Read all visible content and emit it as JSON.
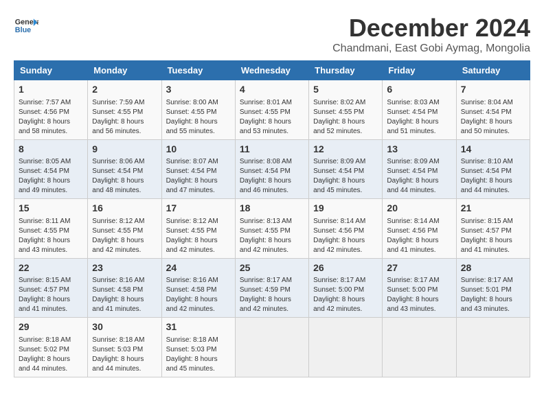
{
  "logo": {
    "line1": "General",
    "line2": "Blue"
  },
  "title": "December 2024",
  "location": "Chandmani, East Gobi Aymag, Mongolia",
  "weekdays": [
    "Sunday",
    "Monday",
    "Tuesday",
    "Wednesday",
    "Thursday",
    "Friday",
    "Saturday"
  ],
  "weeks": [
    [
      {
        "day": "1",
        "rise": "7:57 AM",
        "set": "4:56 PM",
        "daylight": "8 hours and 58 minutes."
      },
      {
        "day": "2",
        "rise": "7:59 AM",
        "set": "4:55 PM",
        "daylight": "8 hours and 56 minutes."
      },
      {
        "day": "3",
        "rise": "8:00 AM",
        "set": "4:55 PM",
        "daylight": "8 hours and 55 minutes."
      },
      {
        "day": "4",
        "rise": "8:01 AM",
        "set": "4:55 PM",
        "daylight": "8 hours and 53 minutes."
      },
      {
        "day": "5",
        "rise": "8:02 AM",
        "set": "4:55 PM",
        "daylight": "8 hours and 52 minutes."
      },
      {
        "day": "6",
        "rise": "8:03 AM",
        "set": "4:54 PM",
        "daylight": "8 hours and 51 minutes."
      },
      {
        "day": "7",
        "rise": "8:04 AM",
        "set": "4:54 PM",
        "daylight": "8 hours and 50 minutes."
      }
    ],
    [
      {
        "day": "8",
        "rise": "8:05 AM",
        "set": "4:54 PM",
        "daylight": "8 hours and 49 minutes."
      },
      {
        "day": "9",
        "rise": "8:06 AM",
        "set": "4:54 PM",
        "daylight": "8 hours and 48 minutes."
      },
      {
        "day": "10",
        "rise": "8:07 AM",
        "set": "4:54 PM",
        "daylight": "8 hours and 47 minutes."
      },
      {
        "day": "11",
        "rise": "8:08 AM",
        "set": "4:54 PM",
        "daylight": "8 hours and 46 minutes."
      },
      {
        "day": "12",
        "rise": "8:09 AM",
        "set": "4:54 PM",
        "daylight": "8 hours and 45 minutes."
      },
      {
        "day": "13",
        "rise": "8:09 AM",
        "set": "4:54 PM",
        "daylight": "8 hours and 44 minutes."
      },
      {
        "day": "14",
        "rise": "8:10 AM",
        "set": "4:54 PM",
        "daylight": "8 hours and 44 minutes."
      }
    ],
    [
      {
        "day": "15",
        "rise": "8:11 AM",
        "set": "4:55 PM",
        "daylight": "8 hours and 43 minutes."
      },
      {
        "day": "16",
        "rise": "8:12 AM",
        "set": "4:55 PM",
        "daylight": "8 hours and 42 minutes."
      },
      {
        "day": "17",
        "rise": "8:12 AM",
        "set": "4:55 PM",
        "daylight": "8 hours and 42 minutes."
      },
      {
        "day": "18",
        "rise": "8:13 AM",
        "set": "4:55 PM",
        "daylight": "8 hours and 42 minutes."
      },
      {
        "day": "19",
        "rise": "8:14 AM",
        "set": "4:56 PM",
        "daylight": "8 hours and 42 minutes."
      },
      {
        "day": "20",
        "rise": "8:14 AM",
        "set": "4:56 PM",
        "daylight": "8 hours and 41 minutes."
      },
      {
        "day": "21",
        "rise": "8:15 AM",
        "set": "4:57 PM",
        "daylight": "8 hours and 41 minutes."
      }
    ],
    [
      {
        "day": "22",
        "rise": "8:15 AM",
        "set": "4:57 PM",
        "daylight": "8 hours and 41 minutes."
      },
      {
        "day": "23",
        "rise": "8:16 AM",
        "set": "4:58 PM",
        "daylight": "8 hours and 41 minutes."
      },
      {
        "day": "24",
        "rise": "8:16 AM",
        "set": "4:58 PM",
        "daylight": "8 hours and 42 minutes."
      },
      {
        "day": "25",
        "rise": "8:17 AM",
        "set": "4:59 PM",
        "daylight": "8 hours and 42 minutes."
      },
      {
        "day": "26",
        "rise": "8:17 AM",
        "set": "5:00 PM",
        "daylight": "8 hours and 42 minutes."
      },
      {
        "day": "27",
        "rise": "8:17 AM",
        "set": "5:00 PM",
        "daylight": "8 hours and 43 minutes."
      },
      {
        "day": "28",
        "rise": "8:17 AM",
        "set": "5:01 PM",
        "daylight": "8 hours and 43 minutes."
      }
    ],
    [
      {
        "day": "29",
        "rise": "8:18 AM",
        "set": "5:02 PM",
        "daylight": "8 hours and 44 minutes."
      },
      {
        "day": "30",
        "rise": "8:18 AM",
        "set": "5:03 PM",
        "daylight": "8 hours and 44 minutes."
      },
      {
        "day": "31",
        "rise": "8:18 AM",
        "set": "5:03 PM",
        "daylight": "8 hours and 45 minutes."
      },
      null,
      null,
      null,
      null
    ]
  ]
}
